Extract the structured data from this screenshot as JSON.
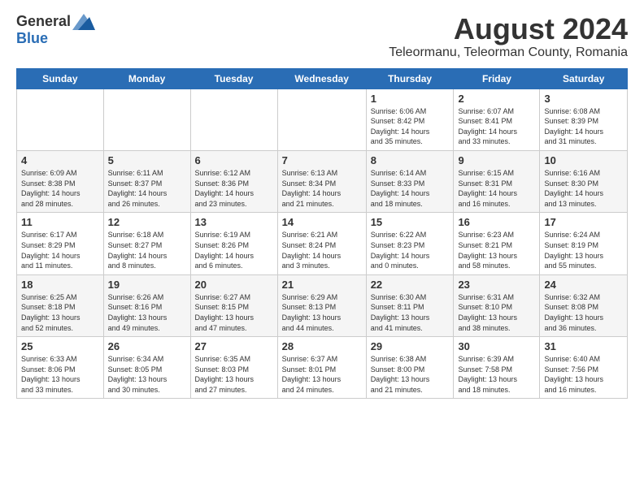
{
  "logo": {
    "general": "General",
    "blue": "Blue"
  },
  "title": "August 2024",
  "subtitle": "Teleormanu, Teleorman County, Romania",
  "headers": [
    "Sunday",
    "Monday",
    "Tuesday",
    "Wednesday",
    "Thursday",
    "Friday",
    "Saturday"
  ],
  "rows": [
    [
      {
        "day": "",
        "info": ""
      },
      {
        "day": "",
        "info": ""
      },
      {
        "day": "",
        "info": ""
      },
      {
        "day": "",
        "info": ""
      },
      {
        "day": "1",
        "info": "Sunrise: 6:06 AM\nSunset: 8:42 PM\nDaylight: 14 hours\nand 35 minutes."
      },
      {
        "day": "2",
        "info": "Sunrise: 6:07 AM\nSunset: 8:41 PM\nDaylight: 14 hours\nand 33 minutes."
      },
      {
        "day": "3",
        "info": "Sunrise: 6:08 AM\nSunset: 8:39 PM\nDaylight: 14 hours\nand 31 minutes."
      }
    ],
    [
      {
        "day": "4",
        "info": "Sunrise: 6:09 AM\nSunset: 8:38 PM\nDaylight: 14 hours\nand 28 minutes."
      },
      {
        "day": "5",
        "info": "Sunrise: 6:11 AM\nSunset: 8:37 PM\nDaylight: 14 hours\nand 26 minutes."
      },
      {
        "day": "6",
        "info": "Sunrise: 6:12 AM\nSunset: 8:36 PM\nDaylight: 14 hours\nand 23 minutes."
      },
      {
        "day": "7",
        "info": "Sunrise: 6:13 AM\nSunset: 8:34 PM\nDaylight: 14 hours\nand 21 minutes."
      },
      {
        "day": "8",
        "info": "Sunrise: 6:14 AM\nSunset: 8:33 PM\nDaylight: 14 hours\nand 18 minutes."
      },
      {
        "day": "9",
        "info": "Sunrise: 6:15 AM\nSunset: 8:31 PM\nDaylight: 14 hours\nand 16 minutes."
      },
      {
        "day": "10",
        "info": "Sunrise: 6:16 AM\nSunset: 8:30 PM\nDaylight: 14 hours\nand 13 minutes."
      }
    ],
    [
      {
        "day": "11",
        "info": "Sunrise: 6:17 AM\nSunset: 8:29 PM\nDaylight: 14 hours\nand 11 minutes."
      },
      {
        "day": "12",
        "info": "Sunrise: 6:18 AM\nSunset: 8:27 PM\nDaylight: 14 hours\nand 8 minutes."
      },
      {
        "day": "13",
        "info": "Sunrise: 6:19 AM\nSunset: 8:26 PM\nDaylight: 14 hours\nand 6 minutes."
      },
      {
        "day": "14",
        "info": "Sunrise: 6:21 AM\nSunset: 8:24 PM\nDaylight: 14 hours\nand 3 minutes."
      },
      {
        "day": "15",
        "info": "Sunrise: 6:22 AM\nSunset: 8:23 PM\nDaylight: 14 hours\nand 0 minutes."
      },
      {
        "day": "16",
        "info": "Sunrise: 6:23 AM\nSunset: 8:21 PM\nDaylight: 13 hours\nand 58 minutes."
      },
      {
        "day": "17",
        "info": "Sunrise: 6:24 AM\nSunset: 8:19 PM\nDaylight: 13 hours\nand 55 minutes."
      }
    ],
    [
      {
        "day": "18",
        "info": "Sunrise: 6:25 AM\nSunset: 8:18 PM\nDaylight: 13 hours\nand 52 minutes."
      },
      {
        "day": "19",
        "info": "Sunrise: 6:26 AM\nSunset: 8:16 PM\nDaylight: 13 hours\nand 49 minutes."
      },
      {
        "day": "20",
        "info": "Sunrise: 6:27 AM\nSunset: 8:15 PM\nDaylight: 13 hours\nand 47 minutes."
      },
      {
        "day": "21",
        "info": "Sunrise: 6:29 AM\nSunset: 8:13 PM\nDaylight: 13 hours\nand 44 minutes."
      },
      {
        "day": "22",
        "info": "Sunrise: 6:30 AM\nSunset: 8:11 PM\nDaylight: 13 hours\nand 41 minutes."
      },
      {
        "day": "23",
        "info": "Sunrise: 6:31 AM\nSunset: 8:10 PM\nDaylight: 13 hours\nand 38 minutes."
      },
      {
        "day": "24",
        "info": "Sunrise: 6:32 AM\nSunset: 8:08 PM\nDaylight: 13 hours\nand 36 minutes."
      }
    ],
    [
      {
        "day": "25",
        "info": "Sunrise: 6:33 AM\nSunset: 8:06 PM\nDaylight: 13 hours\nand 33 minutes."
      },
      {
        "day": "26",
        "info": "Sunrise: 6:34 AM\nSunset: 8:05 PM\nDaylight: 13 hours\nand 30 minutes."
      },
      {
        "day": "27",
        "info": "Sunrise: 6:35 AM\nSunset: 8:03 PM\nDaylight: 13 hours\nand 27 minutes."
      },
      {
        "day": "28",
        "info": "Sunrise: 6:37 AM\nSunset: 8:01 PM\nDaylight: 13 hours\nand 24 minutes."
      },
      {
        "day": "29",
        "info": "Sunrise: 6:38 AM\nSunset: 8:00 PM\nDaylight: 13 hours\nand 21 minutes."
      },
      {
        "day": "30",
        "info": "Sunrise: 6:39 AM\nSunset: 7:58 PM\nDaylight: 13 hours\nand 18 minutes."
      },
      {
        "day": "31",
        "info": "Sunrise: 6:40 AM\nSunset: 7:56 PM\nDaylight: 13 hours\nand 16 minutes."
      }
    ]
  ]
}
